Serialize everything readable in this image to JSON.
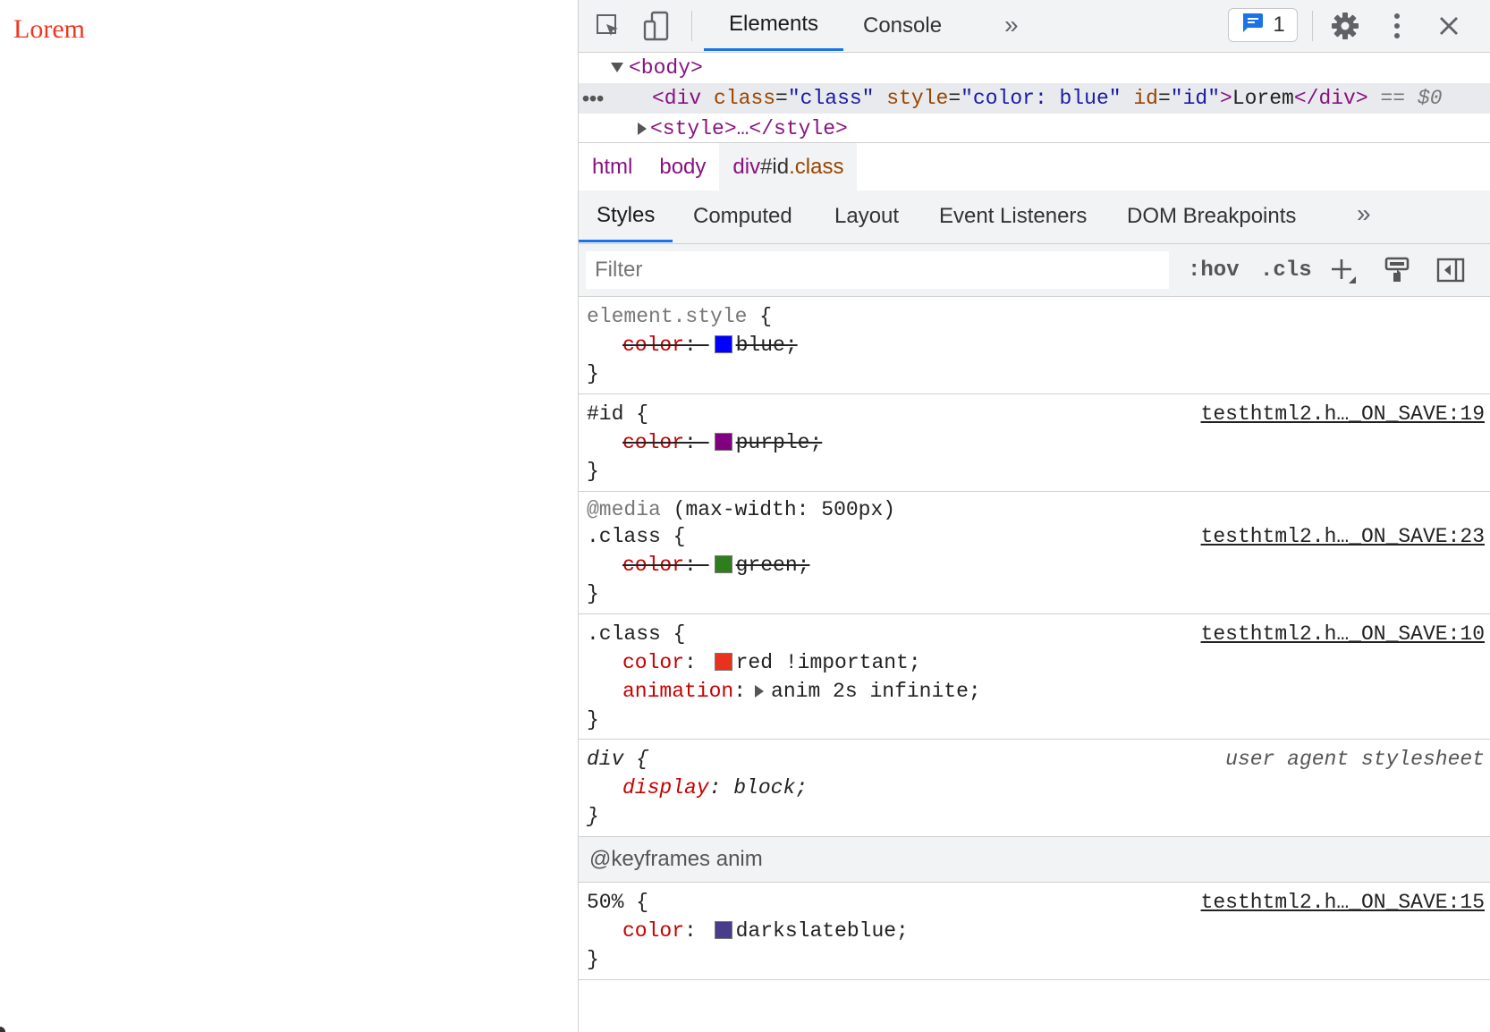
{
  "page": {
    "text": "Lorem"
  },
  "toolbar": {
    "tabs": [
      "Elements",
      "Console"
    ],
    "more_symbol": "»",
    "issues_count": "1"
  },
  "dom": {
    "body_open": "<body>",
    "selected": {
      "tag_open": "<div",
      "attr1_name": "class",
      "attr1_value": "\"class\"",
      "attr2_name": "style",
      "attr2_value": "\"color: blue\"",
      "attr3_name": "id",
      "attr3_value": "\"id\"",
      "tag_close_bracket": ">",
      "text": "Lorem",
      "tag_end": "</div>",
      "marker": "== $0"
    },
    "style_line": "<style>…</style>"
  },
  "breadcrumbs": {
    "html": "html",
    "body": "body",
    "div_tag": "div",
    "div_id": "#id",
    "div_class": ".class"
  },
  "subtabs": [
    "Styles",
    "Computed",
    "Layout",
    "Event Listeners",
    "DOM Breakpoints"
  ],
  "filter": {
    "placeholder": "Filter",
    "hov": ":hov",
    "cls": ".cls"
  },
  "rules": {
    "element_style": {
      "selector": "element.style",
      "prop": "color",
      "value": "blue;",
      "swatch": "#0000ff"
    },
    "id_rule": {
      "selector": "#id",
      "source": "testhtml2.h…_ON_SAVE:19",
      "prop": "color",
      "value": "purple;",
      "swatch": "#800080"
    },
    "media_rule": {
      "media_keyword": "@media",
      "media_query": "(max-width: 500px)",
      "selector": ".class",
      "source": "testhtml2.h…_ON_SAVE:23",
      "prop": "color",
      "value": "green;",
      "swatch": "#2e7d1f"
    },
    "class_rule": {
      "selector": ".class",
      "source": "testhtml2.h…_ON_SAVE:10",
      "prop1": "color",
      "value1": "red !important;",
      "swatch": "#e8321e",
      "prop2": "animation",
      "value2": "anim 2s infinite;"
    },
    "ua_rule": {
      "selector": "div",
      "source": "user agent stylesheet",
      "prop": "display",
      "value": "block;"
    },
    "keyframes": {
      "header": "@keyframes anim",
      "selector": "50%",
      "source": "testhtml2.h…_ON_SAVE:15",
      "prop": "color",
      "value": "darkslateblue;",
      "swatch": "#483d8b"
    }
  }
}
